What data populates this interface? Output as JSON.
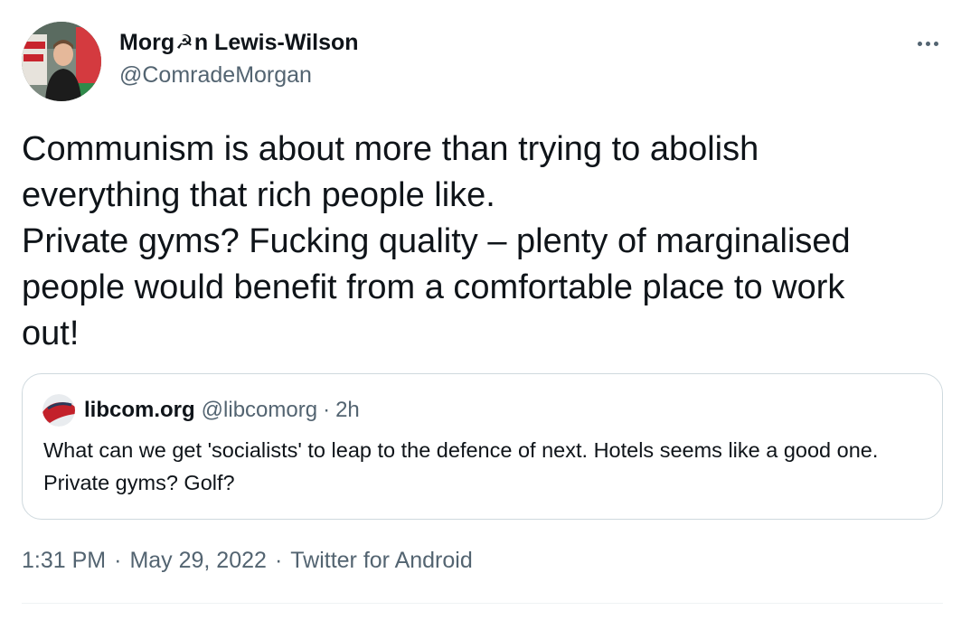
{
  "author": {
    "display_name_part1": "Morg",
    "display_name_emoji": "☭",
    "display_name_part2": "n Lewis-Wilson",
    "handle": "@ComradeMorgan"
  },
  "more_icon": "more-horizontal-icon",
  "tweet_text": "Communism is about more than trying to abolish\neverything that rich people like.\nPrivate gyms? Fucking quality – plenty of marginalised\npeople would benefit from a comfortable place to work\nout!",
  "quoted_tweet": {
    "display_name": "libcom.org",
    "handle": "@libcomorg",
    "separator": "·",
    "time": "2h",
    "text": "What can we get 'socialists' to leap to the defence of next. Hotels seems like a good one. Private gyms? Golf?"
  },
  "meta": {
    "time": "1:31 PM",
    "separator": "·",
    "date": "May 29, 2022",
    "source": "Twitter for Android"
  },
  "colors": {
    "text_primary": "#0f1419",
    "text_secondary": "#536471",
    "border": "#cfd9de"
  }
}
